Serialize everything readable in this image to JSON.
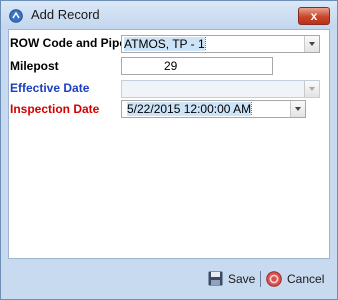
{
  "window": {
    "title": "Add Record",
    "close_glyph": "x"
  },
  "form": {
    "row_code": {
      "label": "ROW Code and Pipe",
      "value": "ATMOS, TP - 1"
    },
    "milepost": {
      "label": "Milepost",
      "value": "29"
    },
    "effective_date": {
      "label": "Effective Date",
      "value": ""
    },
    "inspection_date": {
      "label": "Inspection Date",
      "value": "5/22/2015 12:00:00 AM"
    }
  },
  "footer": {
    "save_label": "Save",
    "cancel_label": "Cancel"
  },
  "colors": {
    "required_label": "#d40000",
    "optional_label": "#1a3fc0",
    "titlebar": "#c3d6ee"
  },
  "icons": {
    "app": "app-logo-icon",
    "save": "floppy-disk-icon",
    "cancel": "cancel-circle-icon"
  }
}
